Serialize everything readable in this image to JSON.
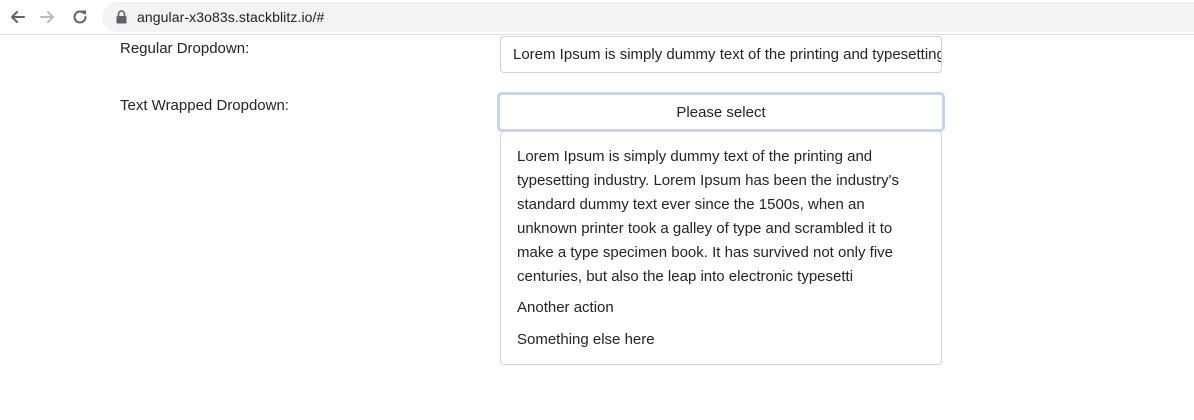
{
  "browser": {
    "back_icon": "arrow-left-icon",
    "forward_icon": "arrow-right-icon",
    "reload_icon": "reload-icon",
    "lock_icon": "lock-icon",
    "url": "angular-x3o83s.stackblitz.io/#"
  },
  "form": {
    "regular_label": "Regular Dropdown:",
    "regular_value": "Lorem Ipsum is simply dummy text of the printing and typesetting industry.",
    "wrapped_label": "Text Wrapped Dropdown:",
    "wrapped_placeholder": "Please select"
  },
  "dropdown": {
    "items": [
      {
        "label": "Lorem Ipsum is simply dummy text of the printing and typesetting industry. Lorem Ipsum has been the industry's standard dummy text ever since the 1500s, when an unknown printer took a galley of type and scrambled it to make a type specimen book. It has survived not only five centuries, but also the leap into electronic typesetti"
      },
      {
        "label": "Another action"
      },
      {
        "label": "Something else here"
      }
    ]
  },
  "colors": {
    "focus_ring": "#c4d5ec",
    "border": "#ced4da",
    "text": "#212529",
    "omnibox_bg": "#f1f3f4"
  }
}
